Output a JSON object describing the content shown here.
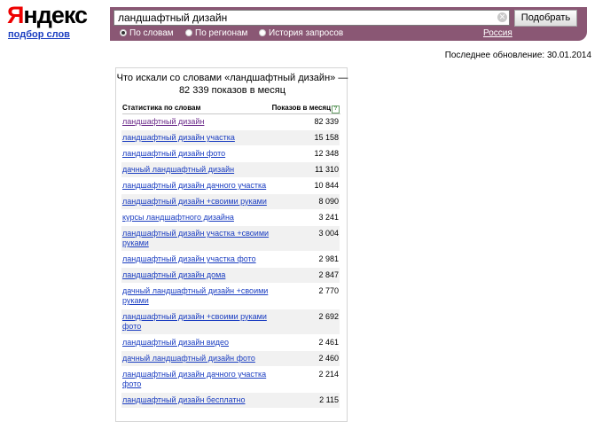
{
  "header": {
    "logo_first": "Я",
    "logo_rest": "ндекс",
    "sublogo": "подбор слов"
  },
  "search": {
    "query": "ландшафтный дизайн",
    "submit_label": "Подобрать",
    "clear_icon": "close-icon",
    "radios": [
      {
        "label": "По словам",
        "checked": true
      },
      {
        "label": "По регионам",
        "checked": false
      },
      {
        "label": "История запросов",
        "checked": false
      }
    ],
    "region": "Россия",
    "accent_color": "#8a5774"
  },
  "last_update": "Последнее обновление: 30.01.2014",
  "panel": {
    "title": "Что искали со словами «ландшафтный дизайн» — 82 339 показов в месяц",
    "col_words": "Статистика по словам",
    "col_shows": "Показов в месяц",
    "help_icon": "?"
  },
  "rows": [
    {
      "keyword": "ландшафтный дизайн",
      "count": "82 339"
    },
    {
      "keyword": "ландшафтный дизайн участка",
      "count": "15 158"
    },
    {
      "keyword": "ландшафтный дизайн фото",
      "count": "12 348"
    },
    {
      "keyword": "дачный ландшафтный дизайн",
      "count": "11 310"
    },
    {
      "keyword": "ландшафтный дизайн дачного участка",
      "count": "10 844"
    },
    {
      "keyword": "ландшафтный дизайн +своими руками",
      "count": "8 090"
    },
    {
      "keyword": "курсы ландшафтного дизайна",
      "count": "3 241"
    },
    {
      "keyword": "ландшафтный дизайн участка +своими руками",
      "count": "3 004"
    },
    {
      "keyword": "ландшафтный дизайн участка фото",
      "count": "2 981"
    },
    {
      "keyword": "ландшафтный дизайн дома",
      "count": "2 847"
    },
    {
      "keyword": "дачный ландшафтный дизайн +своими руками",
      "count": "2 770"
    },
    {
      "keyword": "ландшафтный дизайн +своими руками фото",
      "count": "2 692"
    },
    {
      "keyword": "ландшафтный дизайн видео",
      "count": "2 461"
    },
    {
      "keyword": "дачный ландшафтный дизайн фото",
      "count": "2 460"
    },
    {
      "keyword": "ландшафтный дизайн дачного участка фото",
      "count": "2 214"
    },
    {
      "keyword": "ландшафтный дизайн бесплатно",
      "count": "2 115"
    }
  ]
}
